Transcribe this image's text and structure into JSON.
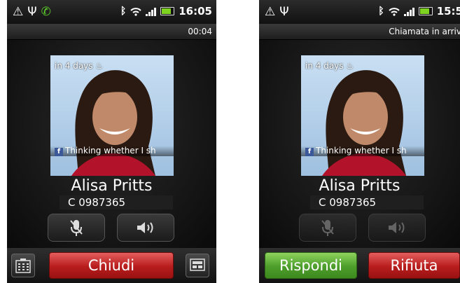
{
  "left_phone": {
    "status_time": "16:05",
    "call_timer": "00:04",
    "days_label": "in 4 days",
    "status_message": "Thinking whether I sh",
    "contact_name": "Alisa Pritts",
    "contact_number": "C 0987365",
    "end_button": "Chiudi",
    "icons": [
      "warning-icon",
      "usb-icon",
      "phone-call-icon",
      "bluetooth-icon",
      "wifi-icon",
      "signal-icon",
      "battery-icon",
      "birthday-cake-icon",
      "facebook-icon",
      "mute-mic-icon",
      "speaker-icon",
      "dialpad-icon",
      "notes-icon"
    ]
  },
  "right_phone": {
    "status_time": "15:5",
    "incoming_label": "Chiamata in arriv",
    "days_label": "in 4 days",
    "status_message": "Thinking whether I sh",
    "contact_name": "Alisa Pritts",
    "contact_number": "C 0987365",
    "answer_button": "Rispondi",
    "decline_button": "Rifiuta"
  },
  "colors": {
    "answer_green": "#4c9d2a",
    "decline_red": "#b81d1d",
    "background": "#0d0d0d"
  }
}
